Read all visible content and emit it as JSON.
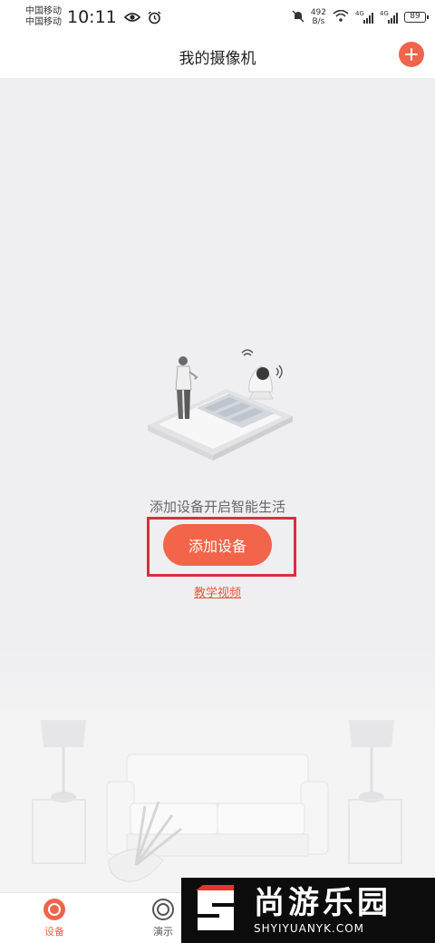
{
  "status_bar": {
    "carrier_1": "中国移动",
    "carrier_2": "中国移动",
    "time": "10:11",
    "net_speed_value": "492",
    "net_speed_unit": "B/s",
    "sim1_type": "4G",
    "sim2_type": "4G",
    "battery": "89"
  },
  "header": {
    "title": "我的摄像机",
    "add_icon": "plus-icon",
    "accent_color": "#f0644a"
  },
  "main": {
    "empty_tip": "添加设备开启智能生活",
    "add_device_label": "添加设备",
    "tutorial_link": "教学视频"
  },
  "bottom_nav": {
    "items": [
      {
        "label": "设备",
        "icon": "camera-icon",
        "active": true
      },
      {
        "label": "演示",
        "icon": "demo-icon",
        "active": false
      }
    ]
  },
  "watermark": {
    "cn": "尚游乐园",
    "en": "SHYIYUANYK.COM"
  }
}
